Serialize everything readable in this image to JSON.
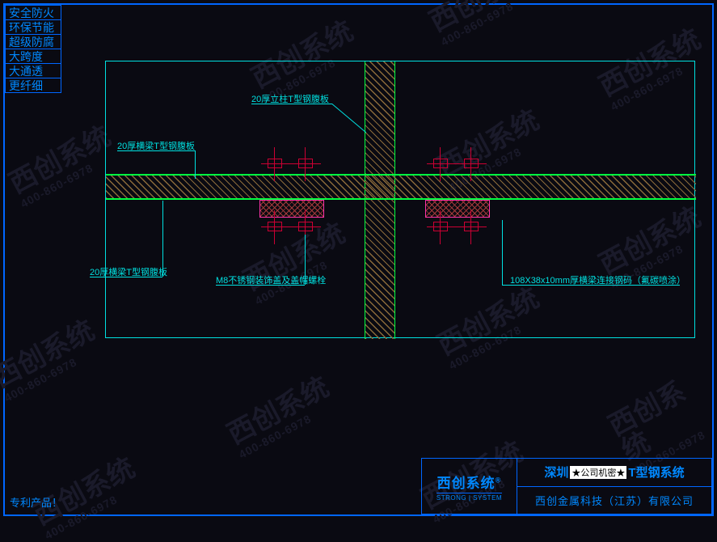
{
  "tags": [
    "安全防火",
    "环保节能",
    "超级防腐",
    "大跨度",
    "大通透",
    "更纤细"
  ],
  "annotations": {
    "top": "20厚立柱T型钢腹板",
    "left1": "20厚横梁T型钢腹板",
    "left2": "20厚横梁T型钢腹板",
    "bolt": "M8不锈钢装饰盖及盖帽螺栓",
    "right": "108X38x10mm厚横梁连接钢码（氟碳喷涂）"
  },
  "watermark": {
    "main": "西创系统",
    "sub": "400-860-6978"
  },
  "titleblock": {
    "brand": "西创系统",
    "brand_sup": "®",
    "brand_en": "STRONG | SYSTEM",
    "title_pre": "深圳",
    "title_chip": "★公司机密★",
    "title_post": "T型钢系统",
    "company": "西创金属科技（江苏）有限公司"
  },
  "patent": "专利产品！"
}
